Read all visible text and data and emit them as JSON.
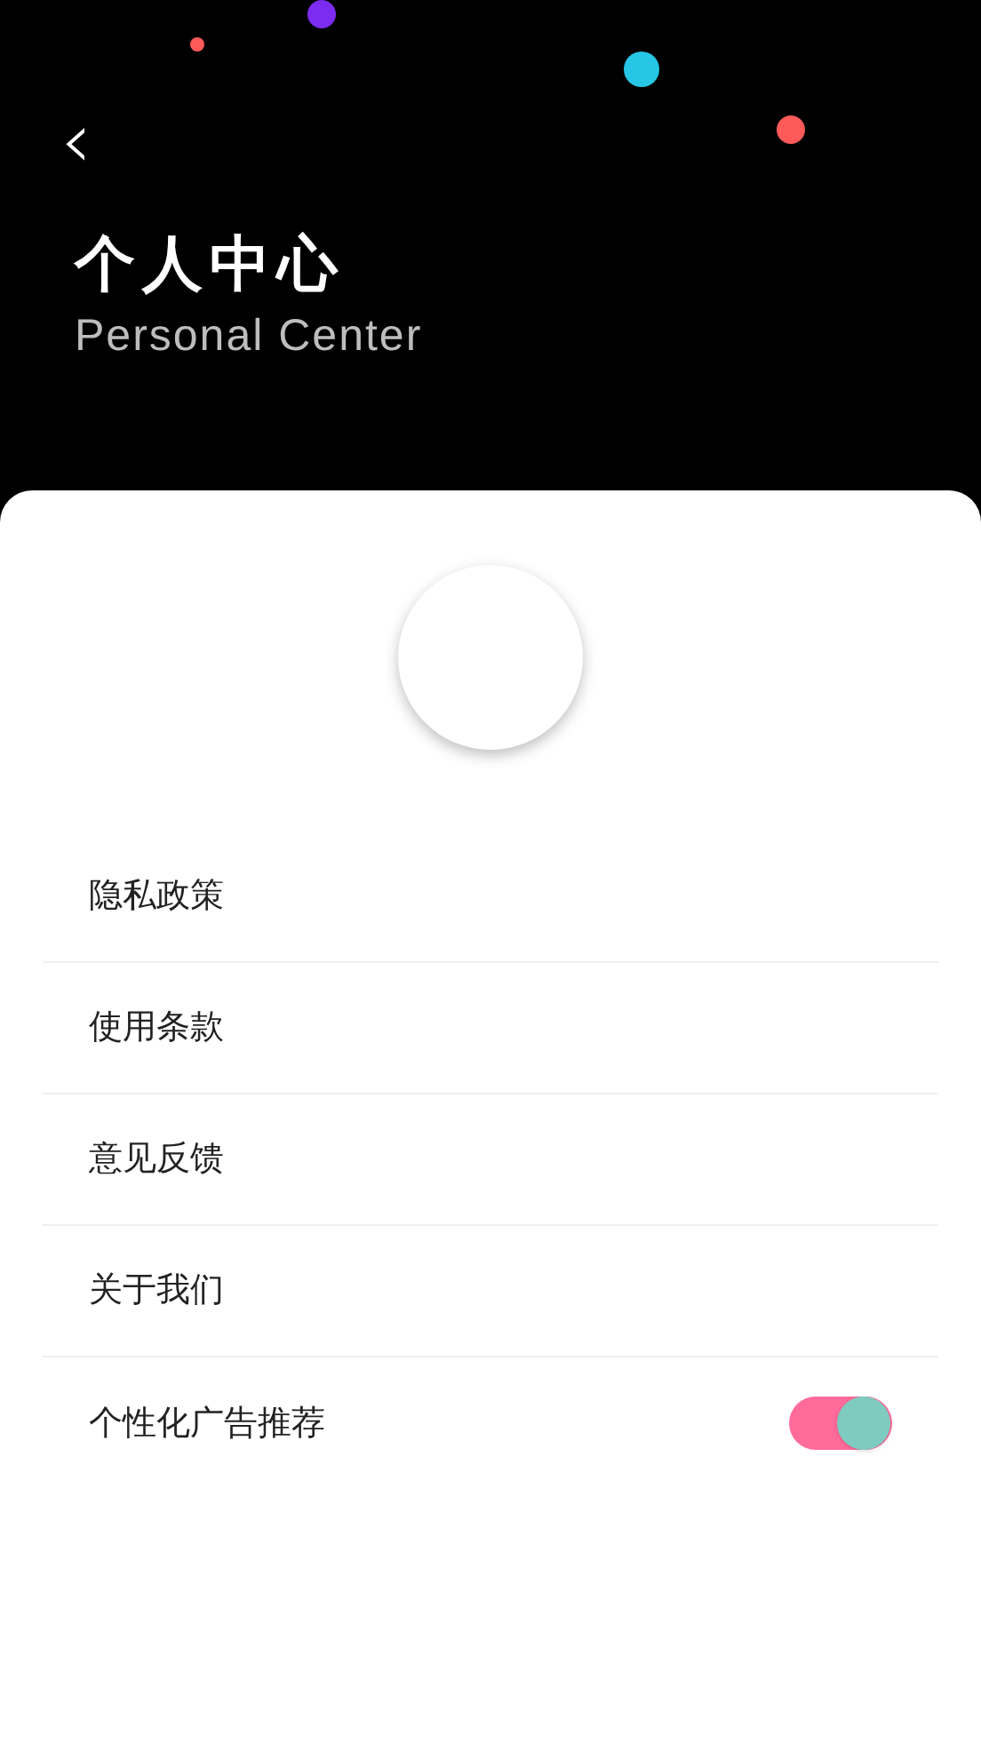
{
  "header": {
    "back_icon": "‹",
    "title": "个人中心",
    "subtitle": "Personal Center"
  },
  "menu": [
    {
      "kind": "link",
      "label": "隐私政策"
    },
    {
      "kind": "link",
      "label": "使用条款"
    },
    {
      "kind": "link",
      "label": "意见反馈"
    },
    {
      "kind": "link",
      "label": "关于我们"
    },
    {
      "kind": "toggle",
      "label": "个性化广告推荐",
      "on": true
    }
  ]
}
